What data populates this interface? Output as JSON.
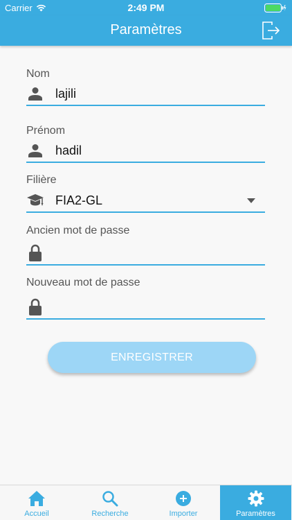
{
  "status_bar": {
    "carrier": "Carrier",
    "time": "2:49 PM"
  },
  "header": {
    "title": "Paramètres",
    "logout_icon": "logout-icon"
  },
  "form": {
    "nom": {
      "label": "Nom",
      "value": "lajili",
      "icon": "person-icon"
    },
    "prenom": {
      "label": "Prénom",
      "value": "hadil",
      "icon": "person-icon"
    },
    "filiere": {
      "label": "Filière",
      "value": "FIA2-GL",
      "icon": "graduation-cap-icon"
    },
    "ancien_mdp": {
      "label": "Ancien mot de passe",
      "value": "",
      "icon": "lock-icon"
    },
    "nouveau_mdp": {
      "label": "Nouveau mot de passe",
      "value": "",
      "icon": "lock-icon"
    },
    "save_label": "ENREGISTRER"
  },
  "tabs": [
    {
      "label": "Accueil",
      "icon": "home-icon",
      "active": false
    },
    {
      "label": "Recherche",
      "icon": "search-icon",
      "active": false
    },
    {
      "label": "Importer",
      "icon": "plus-circle-icon",
      "active": false
    },
    {
      "label": "Paramètres",
      "icon": "gear-icon",
      "active": true
    }
  ],
  "colors": {
    "primary": "#3aace0",
    "button": "#9dd6f6",
    "background": "#f8f8f8"
  }
}
